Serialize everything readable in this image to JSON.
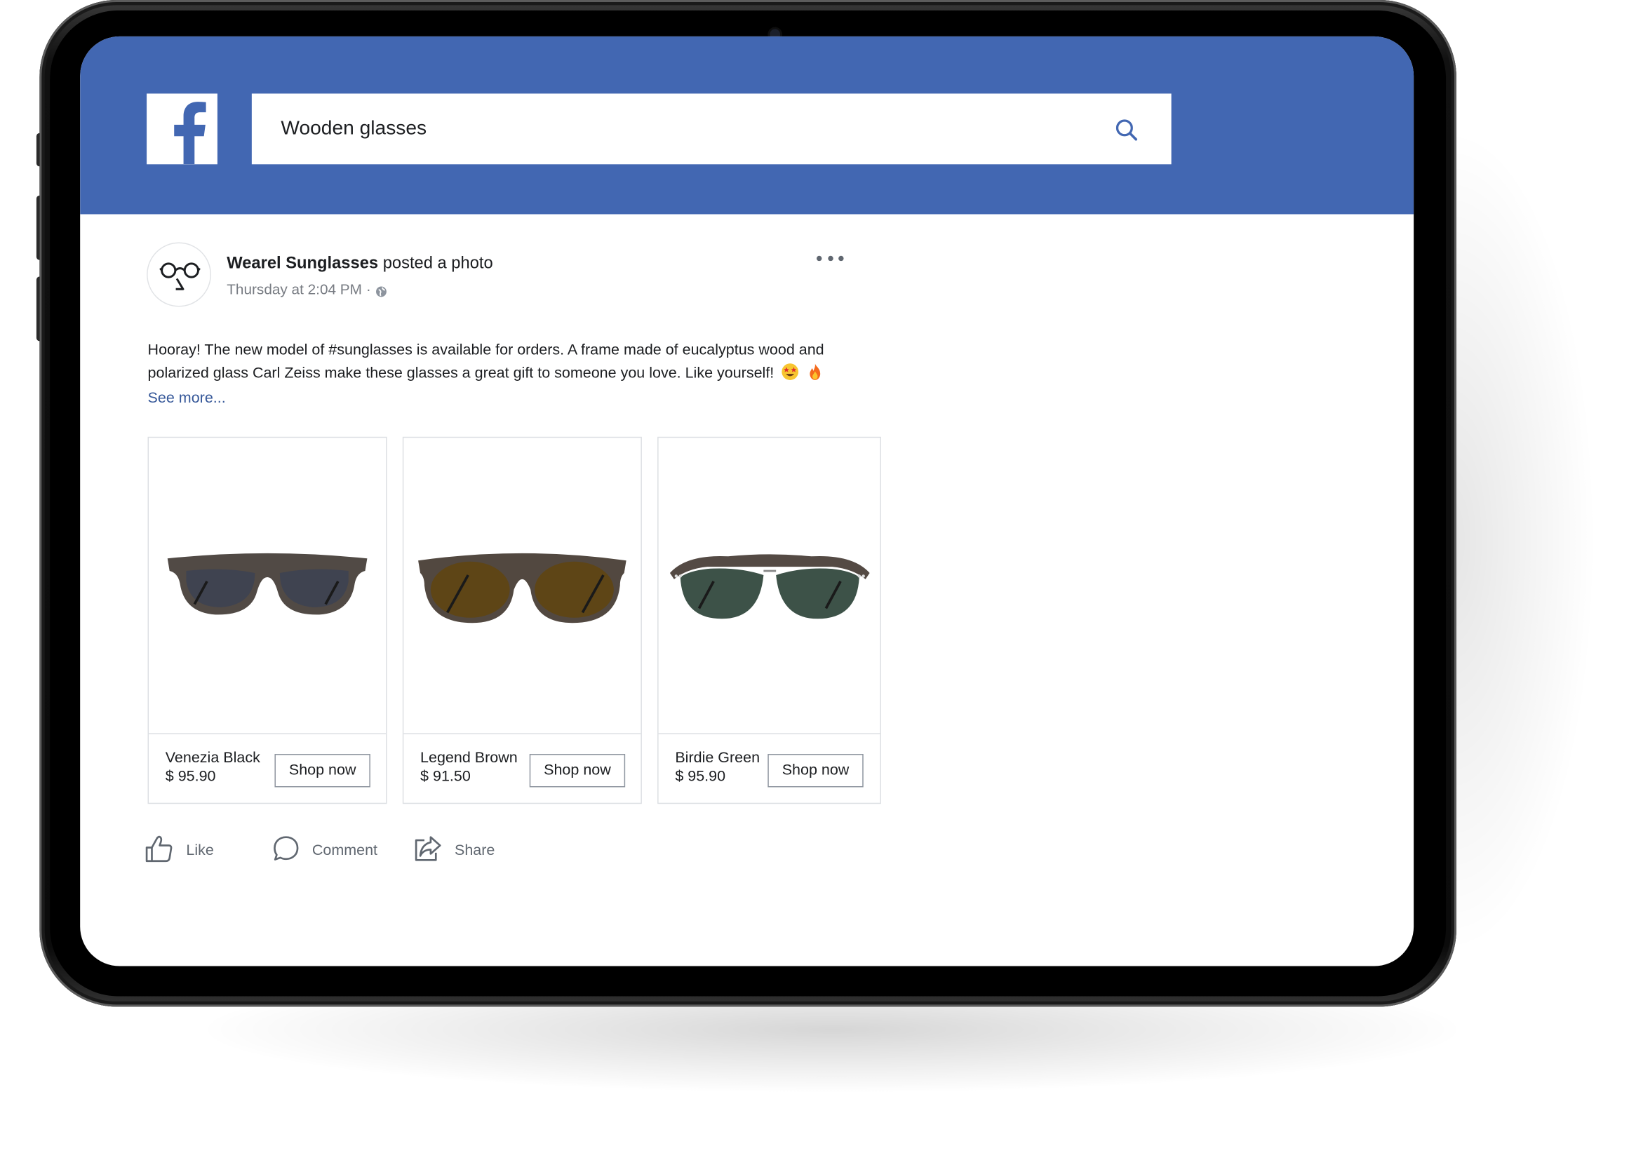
{
  "search": {
    "value": "Wooden glasses",
    "placeholder": ""
  },
  "post": {
    "author": "Wearel Sunglasses",
    "action_text": "posted a photo",
    "timestamp": "Thursday at 2:04 PM",
    "separator": "·",
    "text": "Hooray! The new model of #sunglasses is available for orders. A frame made of eucalyptus wood and polarized glass Carl Zeiss make these glasses a great gift to someone you love. Like yourself!",
    "see_more": "See more..."
  },
  "products": [
    {
      "name": "Venezia Black",
      "price": "$ 95.90",
      "button": "Shop now",
      "lens_color": "#3f4350"
    },
    {
      "name": "Legend Brown",
      "price": "$ 91.50",
      "button": "Shop now",
      "lens_color": "#5e4516"
    },
    {
      "name": "Birdie Green",
      "price": "$ 95.90",
      "button": "Shop now",
      "lens_color": "#3d5248"
    }
  ],
  "actions": {
    "like": "Like",
    "comment": "Comment",
    "share": "Share"
  },
  "colors": {
    "brand": "#4267b2",
    "link": "#365899",
    "text": "#1c1e21",
    "muted": "#606770"
  }
}
